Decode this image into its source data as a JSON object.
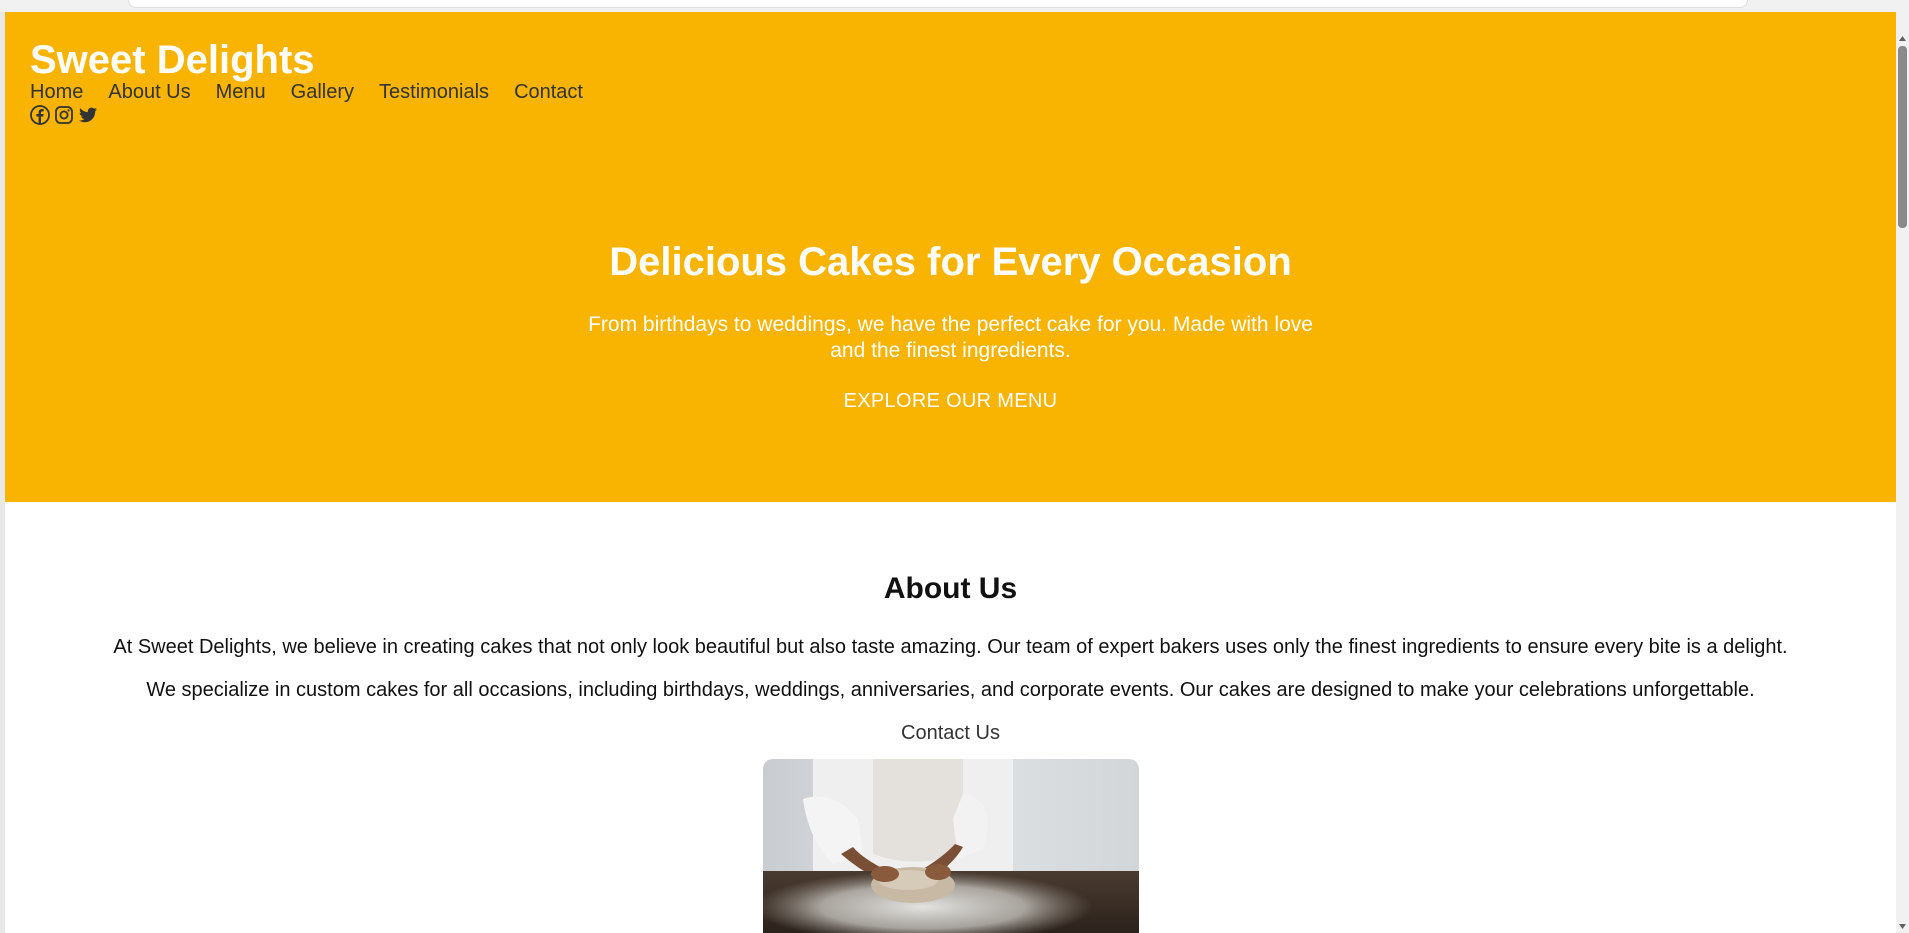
{
  "header": {
    "brand": "Sweet Delights",
    "nav": [
      "Home",
      "About Us",
      "Menu",
      "Gallery",
      "Testimonials",
      "Contact"
    ],
    "social_icons": [
      "facebook-icon",
      "instagram-icon",
      "twitter-icon"
    ]
  },
  "hero": {
    "title": "Delicious Cakes for Every Occasion",
    "subtitle": "From birthdays to weddings, we have the perfect cake for you. Made with love and the finest ingredients.",
    "cta": "EXPLORE OUR MENU"
  },
  "about": {
    "title": "About Us",
    "paragraphs": [
      "At Sweet Delights, we believe in creating cakes that not only look beautiful but also taste amazing. Our team of expert bakers uses only the finest ingredients to ensure every bite is a delight.",
      "We specialize in custom cakes for all occasions, including birthdays, weddings, anniversaries, and corporate events. Our cakes are designed to make your celebrations unforgettable."
    ],
    "contact_link": "Contact Us"
  },
  "colors": {
    "hero_background": "#f8b400",
    "hero_text": "#ffffff",
    "nav_text": "#333333"
  }
}
